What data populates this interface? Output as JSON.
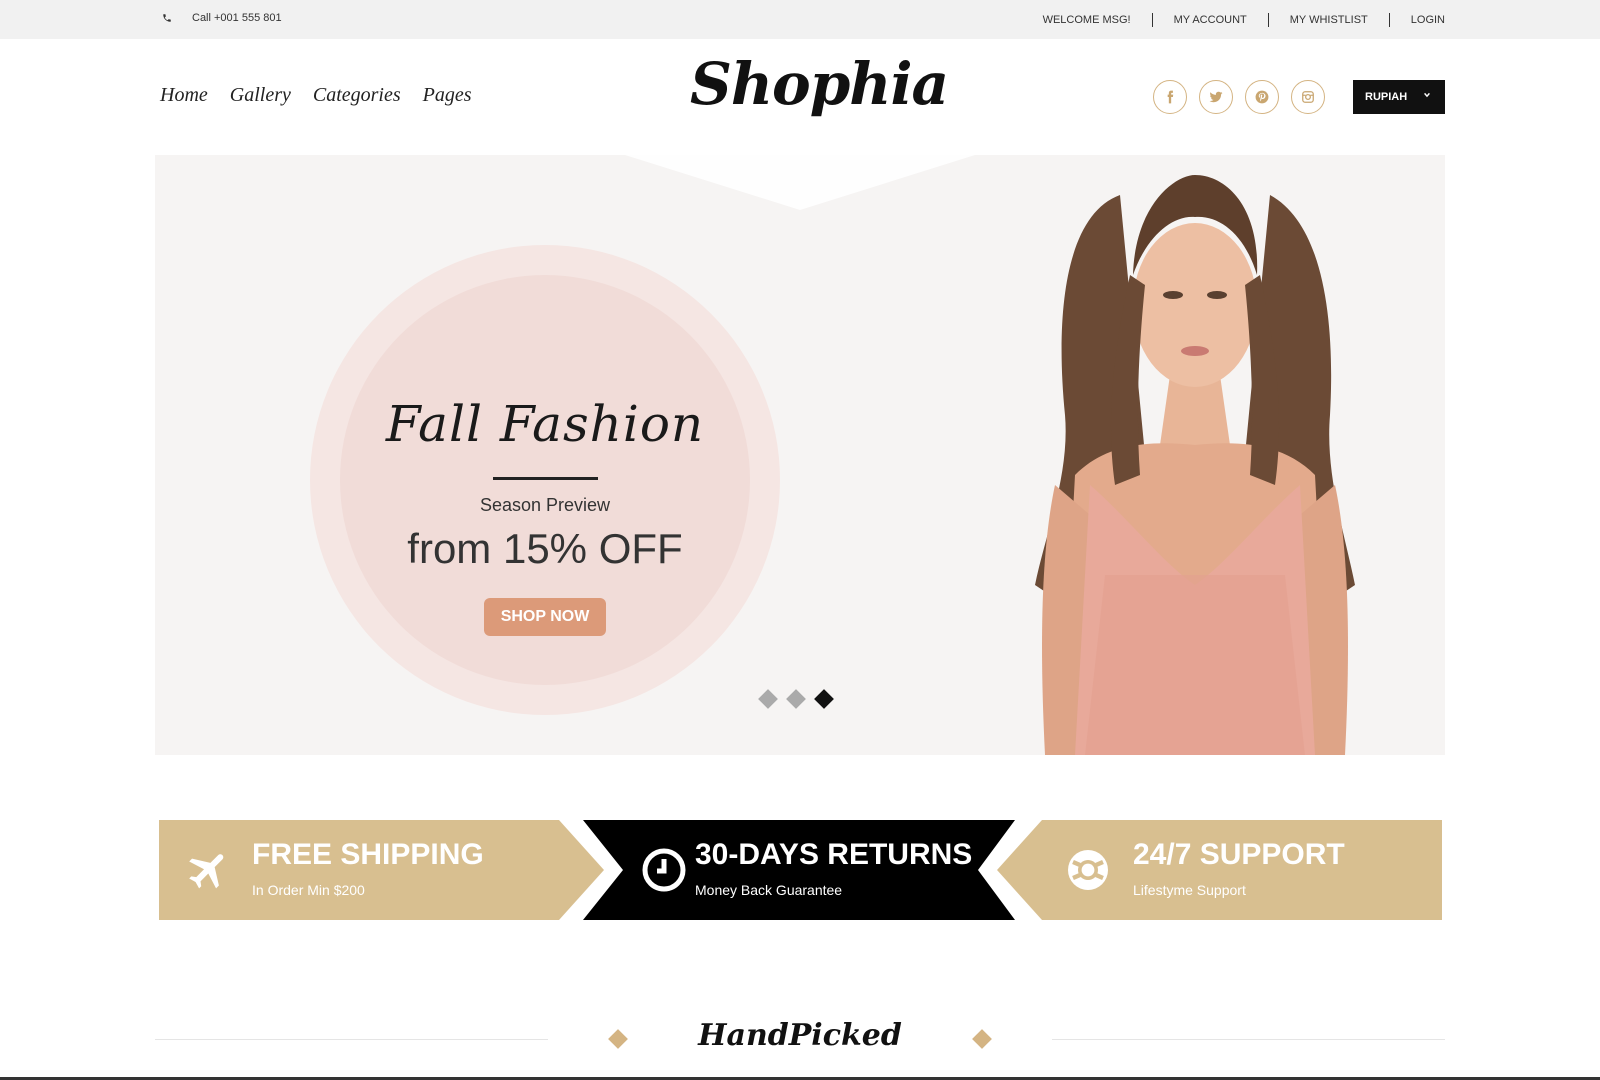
{
  "topbar": {
    "phone_icon": "phone-icon",
    "phone": "Call +001 555 801",
    "links": [
      "WELCOME MSG!",
      "MY ACCOUNT",
      "MY WHISTLIST",
      "LOGIN"
    ]
  },
  "header": {
    "nav": [
      "Home",
      "Gallery",
      "Categories",
      "Pages"
    ],
    "logo": "Shophia",
    "social_icons": [
      "facebook-icon",
      "twitter-icon",
      "pinterest-icon",
      "instagram-icon"
    ],
    "currency": "RUPIAH",
    "accent_color": "#d4b483"
  },
  "hero": {
    "headline": "Fall Fashion",
    "subtitle": "Season Preview",
    "offer": "from 15% OFF",
    "button": "SHOP NOW",
    "slides_total": 3,
    "active_slide": 3
  },
  "features": [
    {
      "title": "FREE SHIPPING",
      "subtitle": "In Order Min $200",
      "icon": "airplane-icon",
      "color": "#d8bf90"
    },
    {
      "title": "30-DAYS RETURNS",
      "subtitle": "Money Back Guarantee",
      "icon": "clock-icon",
      "color": "#000000"
    },
    {
      "title": "24/7 SUPPORT",
      "subtitle": "Lifestyme Support",
      "icon": "lifebuoy-icon",
      "color": "#d8bf90"
    }
  ],
  "section": {
    "title": "HandPicked"
  }
}
